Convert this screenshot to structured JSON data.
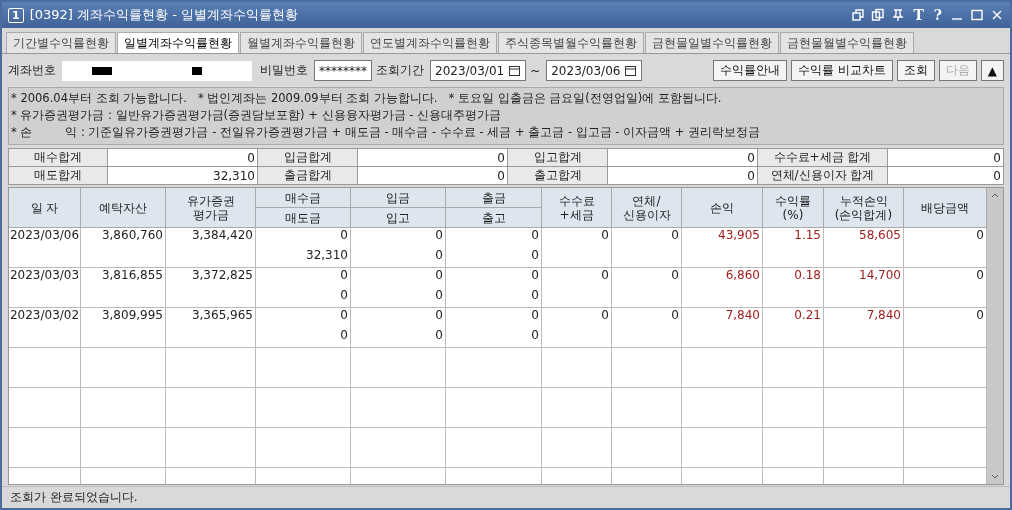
{
  "window": {
    "badge": "1",
    "title": "[0392] 계좌수익률현황 - 일별계좌수익률현황",
    "tools": [
      "T",
      "?"
    ]
  },
  "tabs": [
    {
      "label": "기간별수익률현황",
      "selected": false
    },
    {
      "label": "일별계좌수익률현황",
      "selected": true
    },
    {
      "label": "월별계좌수익률현황",
      "selected": false
    },
    {
      "label": "연도별계좌수익률현황",
      "selected": false
    },
    {
      "label": "주식종목별월수익률현황",
      "selected": false
    },
    {
      "label": "금현물일별수익률현황",
      "selected": false
    },
    {
      "label": "금현물월별수익률현황",
      "selected": false
    }
  ],
  "query": {
    "account_label": "계좌번호",
    "password_label": "비밀번호",
    "password_value": "********",
    "period_label": "조회기간",
    "date_from": "2023/03/01",
    "separator": "~",
    "date_to": "2023/03/06",
    "buttons": [
      {
        "label": "수익률안내",
        "disabled": false
      },
      {
        "label": "수익률 비교차트",
        "disabled": false
      },
      {
        "label": "조회",
        "disabled": false
      },
      {
        "label": "다음",
        "disabled": true
      },
      {
        "label": "▲",
        "disabled": false
      }
    ]
  },
  "notes": [
    "* 2006.04부터 조회 가능합니다.   * 법인계좌는 2009.09부터 조회 가능합니다.   * 토요일 입출금은 금요일(전영업일)에 포함됩니다.",
    "* 유가증권평가금 : 일반유가증권평가금(증권담보포함) + 신용융자평가금 - 신용대주평가금",
    "* 손         익 : 기준일유가증권평가금 - 전일유가증권평가금 + 매도금 - 매수금 - 수수료 - 세금 + 출고금 - 입고금 - 이자금액 + 권리락보정금"
  ],
  "summary": [
    [
      {
        "label": "매수합계",
        "value": "0"
      },
      {
        "label": "입금합계",
        "value": "0"
      },
      {
        "label": "입고합계",
        "value": "0"
      },
      {
        "label": "수수료+세금 합계",
        "value": "0"
      }
    ],
    [
      {
        "label": "매도합계",
        "value": "32,310"
      },
      {
        "label": "출금합계",
        "value": "0"
      },
      {
        "label": "출고합계",
        "value": "0"
      },
      {
        "label": "연체/신용이자 합계",
        "value": "0"
      }
    ]
  ],
  "table": {
    "columns": [
      {
        "top": "일 자",
        "kind": "single",
        "emphasis": false
      },
      {
        "top": "예탁자산",
        "kind": "single",
        "emphasis": false
      },
      {
        "top": "유가증권",
        "bottom": "평가금",
        "kind": "wrap",
        "emphasis": false
      },
      {
        "top": "매수금",
        "bottom": "매도금",
        "kind": "split",
        "emphasis": false
      },
      {
        "top": "입금",
        "bottom": "입고",
        "kind": "split",
        "emphasis": false
      },
      {
        "top": "출금",
        "bottom": "출고",
        "kind": "split",
        "emphasis": false
      },
      {
        "top": "수수료",
        "bottom": "+세금",
        "kind": "wrap",
        "emphasis": false
      },
      {
        "top": "연체/",
        "bottom": "신용이자",
        "kind": "wrap",
        "emphasis": false
      },
      {
        "top": "손익",
        "kind": "single",
        "emphasis": true
      },
      {
        "top": "수익률",
        "bottom": "(%)",
        "kind": "wrap",
        "emphasis": true
      },
      {
        "top": "누적손익",
        "bottom": "(손익합계)",
        "kind": "wrap",
        "emphasis": true
      },
      {
        "top": "배당금액",
        "kind": "single",
        "emphasis": false
      }
    ],
    "rows": [
      {
        "cells": [
          [
            "2023/03/06"
          ],
          [
            "3,860,760"
          ],
          [
            "3,384,420"
          ],
          [
            "0",
            "32,310"
          ],
          [
            "0",
            "0"
          ],
          [
            "0",
            "0"
          ],
          [
            "0"
          ],
          [
            "0"
          ],
          [
            "43,905"
          ],
          [
            "1.15"
          ],
          [
            "58,605"
          ],
          [
            "0"
          ]
        ]
      },
      {
        "cells": [
          [
            "2023/03/03"
          ],
          [
            "3,816,855"
          ],
          [
            "3,372,825"
          ],
          [
            "0",
            "0"
          ],
          [
            "0",
            "0"
          ],
          [
            "0",
            "0"
          ],
          [
            "0"
          ],
          [
            "0"
          ],
          [
            "6,860"
          ],
          [
            "0.18"
          ],
          [
            "14,700"
          ],
          [
            "0"
          ]
        ]
      },
      {
        "cells": [
          [
            "2023/03/02"
          ],
          [
            "3,809,995"
          ],
          [
            "3,365,965"
          ],
          [
            "0",
            "0"
          ],
          [
            "0",
            "0"
          ],
          [
            "0",
            "0"
          ],
          [
            "0"
          ],
          [
            "0"
          ],
          [
            "7,840"
          ],
          [
            "0.21"
          ],
          [
            "7,840"
          ],
          [
            "0"
          ]
        ]
      }
    ]
  },
  "status_bar": "조회가 완료되었습니다."
}
